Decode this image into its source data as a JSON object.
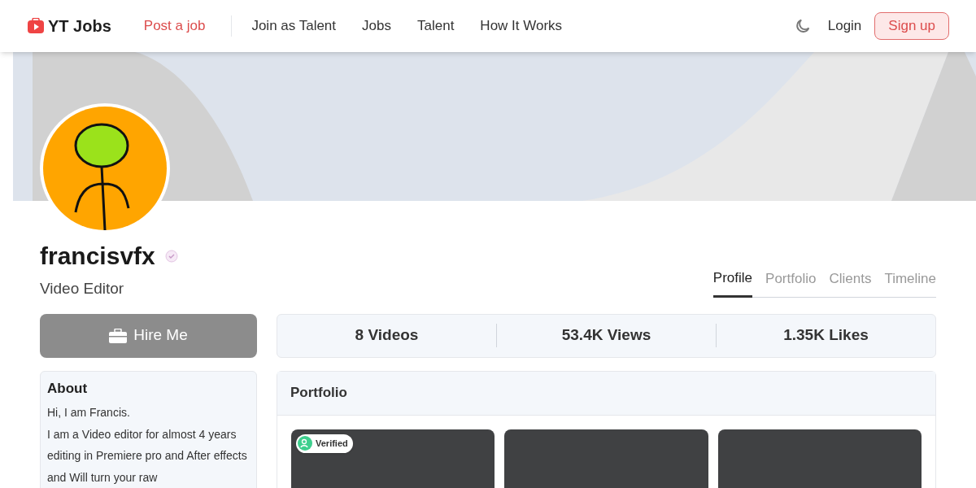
{
  "header": {
    "logo": "YT Jobs",
    "post_job": "Post a job",
    "nav": [
      "Join as Talent",
      "Jobs",
      "Talent",
      "How It Works"
    ],
    "login": "Login",
    "signup": "Sign up"
  },
  "profile": {
    "username": "francisvfx",
    "verified": true,
    "role": "Video Editor"
  },
  "tabs": [
    {
      "label": "Profile",
      "selected": true
    },
    {
      "label": "Portfolio",
      "selected": false
    },
    {
      "label": "Clients",
      "selected": false
    },
    {
      "label": "Timeline",
      "selected": false
    }
  ],
  "hire_button": "Hire Me",
  "stats": [
    "8 Videos",
    "53.4K Views",
    "1.35K Likes"
  ],
  "about": {
    "title": "About",
    "paragraphs": [
      "Hi, I am Francis.",
      "I am a Video editor for almost 4 years editing in Premiere pro and After effects and Will turn your raw"
    ]
  },
  "portfolio": {
    "title": "Portfolio",
    "videos": [
      {
        "verified": true,
        "badge": "Verified"
      },
      {
        "verified": false
      },
      {
        "verified": false
      }
    ]
  }
}
